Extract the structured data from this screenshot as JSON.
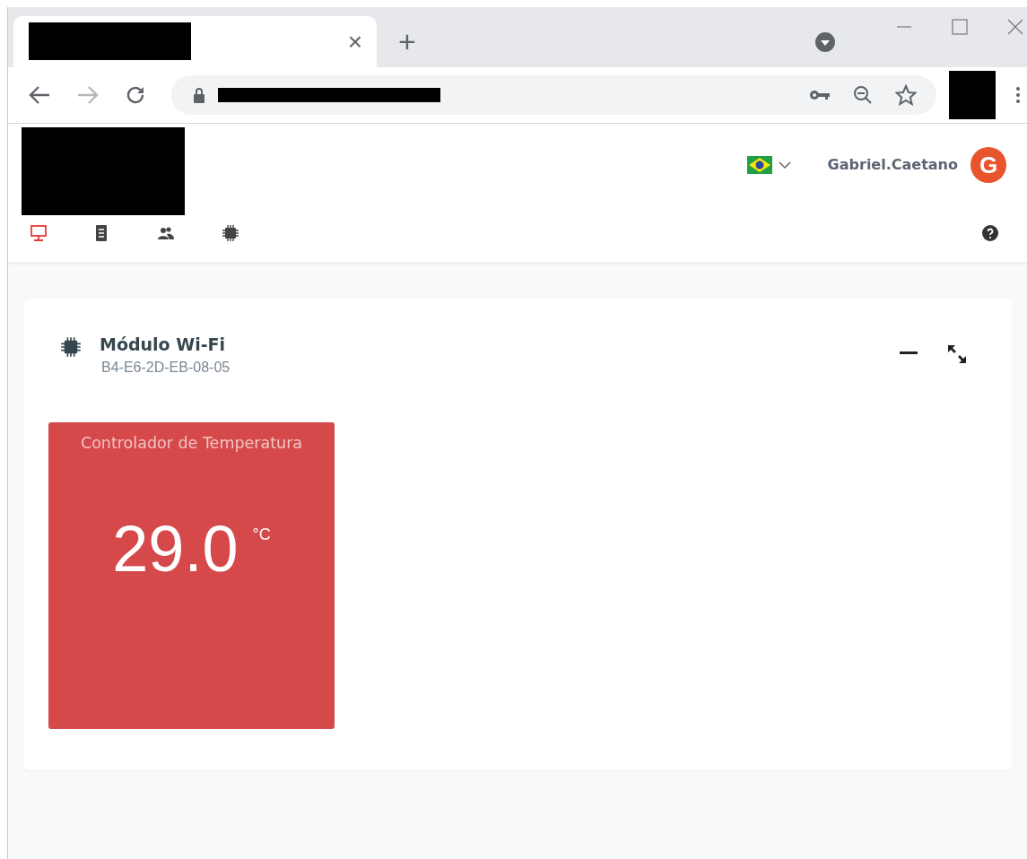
{
  "browser": {
    "tab_close": "×",
    "new_tab": "+"
  },
  "header": {
    "user": "Gabriel.Caetano",
    "avatar_letter": "G"
  },
  "nav_items": [
    {
      "kind": "monitor",
      "selected": true
    },
    {
      "kind": "document",
      "selected": false
    },
    {
      "kind": "users",
      "selected": false
    },
    {
      "kind": "chip",
      "selected": false
    }
  ],
  "device_card": {
    "title": "Módulo Wi-Fi",
    "subtitle": "B4-E6-2D-EB-08-05",
    "tiles": [
      {
        "title": "Controlador de Temperatura",
        "value": "29.0",
        "unit": "°C",
        "color": "#d5494b"
      }
    ]
  }
}
